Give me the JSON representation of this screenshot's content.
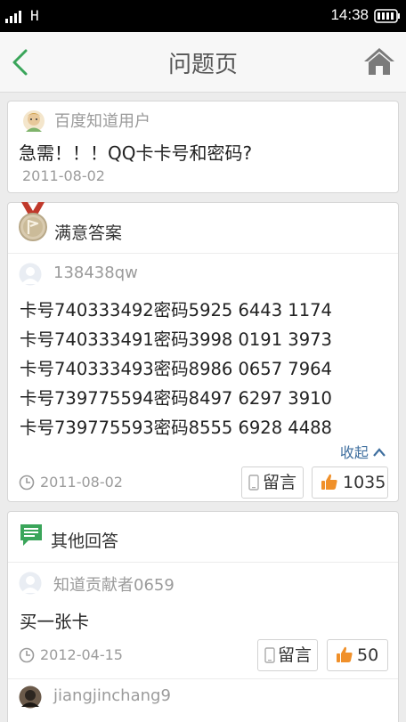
{
  "status_bar": {
    "network": "H",
    "time": "14:38"
  },
  "nav": {
    "title": "问题页"
  },
  "question": {
    "user": "百度知道用户",
    "title": "急需！！！QQ卡卡号和密码?",
    "date": "2011-08-02"
  },
  "best_answer": {
    "label": "满意答案",
    "user": "138438qw",
    "lines": [
      "卡号740333492密码5925  6443  1174",
      "卡号740333491密码3998  0191  3973",
      "卡号740333493密码8986  0657  7964",
      "卡号739775594密码8497  6297  3910",
      "卡号739775593密码8555  6928  4488"
    ],
    "collapse_label": "收起",
    "date": "2011-08-02",
    "comment_label": "留言",
    "likes": "1035"
  },
  "other_answers": {
    "label": "其他回答",
    "items": [
      {
        "user": "知道贡献者0659",
        "text": "买一张卡",
        "date": "2012-04-15",
        "comment_label": "留言",
        "likes": "50"
      },
      {
        "user": "jiangjinchang9"
      }
    ]
  },
  "colors": {
    "accent_green": "#3aa55a",
    "link_blue": "#3f6f9f",
    "like_orange": "#f0902a"
  }
}
